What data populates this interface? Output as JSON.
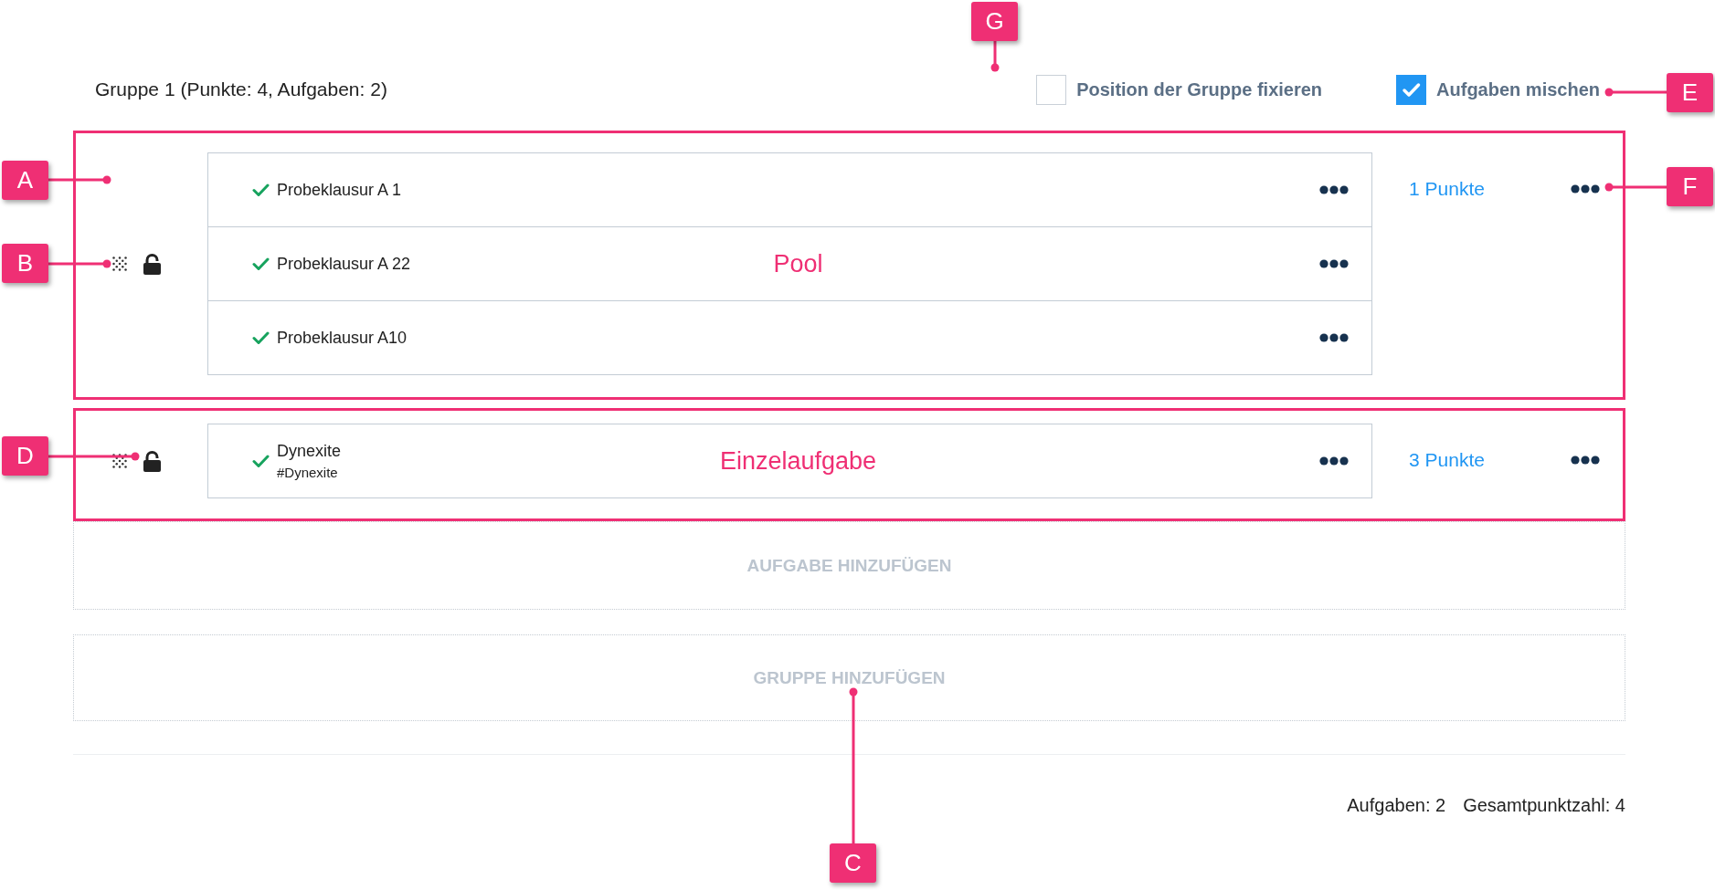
{
  "group": {
    "title": "Gruppe 1 (Punkte: 4, Aufgaben: 2)",
    "options": [
      {
        "label": "Position der Gruppe fixieren",
        "checked": false
      },
      {
        "label": "Aufgaben mischen",
        "checked": true
      }
    ]
  },
  "items": [
    {
      "kind": "pool",
      "locked": false,
      "annotation": "Pool",
      "tasks": [
        {
          "title": "Probeklausur A 1"
        },
        {
          "title": "Probeklausur A 22"
        },
        {
          "title": "Probeklausur A10"
        }
      ],
      "points": "1 Punkte"
    },
    {
      "kind": "single",
      "locked": false,
      "annotation": "Einzelaufgabe",
      "tasks": [
        {
          "title": "Dynexite",
          "tag": "#Dynexite"
        }
      ],
      "points": "3 Punkte"
    }
  ],
  "add_task": {
    "label": "AUFGABE HINZUFÜGEN"
  },
  "add_group": {
    "label": "GRUPPE HINZUFÜGEN"
  },
  "footer": {
    "task_count": "Aufgaben: 2",
    "total_points": "Gesamtpunktzahl: 4"
  },
  "callouts": [
    {
      "letter": "G"
    },
    {
      "letter": "E"
    },
    {
      "letter": "A"
    },
    {
      "letter": "F"
    },
    {
      "letter": "B"
    },
    {
      "letter": "D"
    },
    {
      "letter": "C"
    }
  ]
}
